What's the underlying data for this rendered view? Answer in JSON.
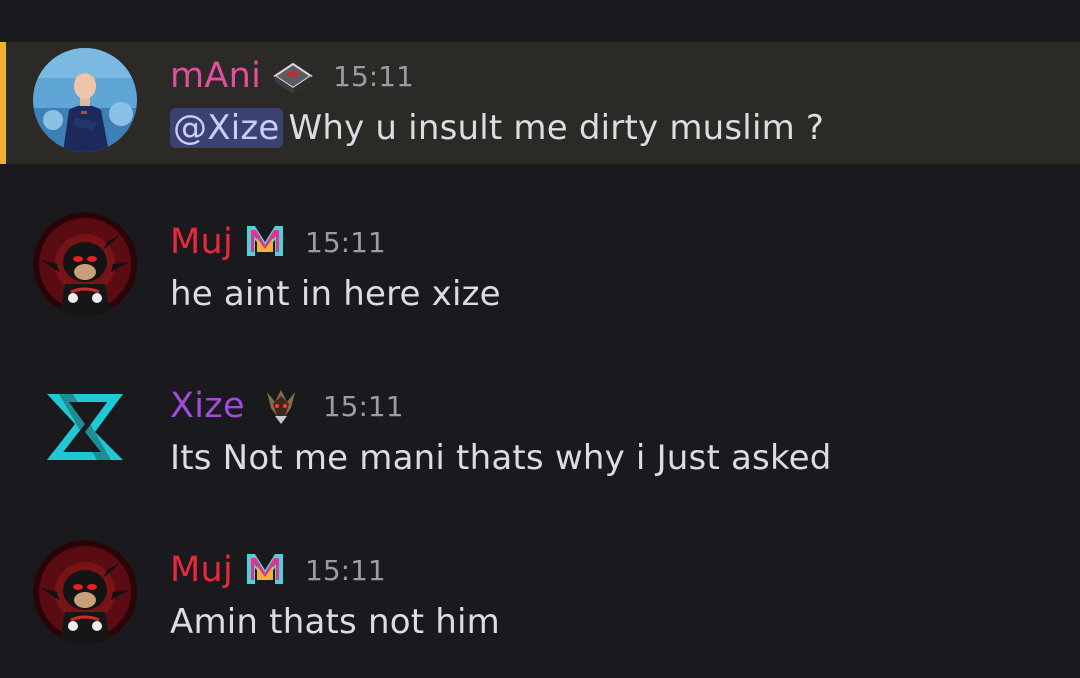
{
  "messages": [
    {
      "username": "mAni",
      "username_color": "#e0509f",
      "badge": "dark-gem-badge-icon",
      "timestamp": "15:11",
      "mention": "@Xize",
      "text": "Why u insult me dirty muslim ?",
      "highlighted": true,
      "avatar": "footballer-avatar"
    },
    {
      "username": "Muj",
      "username_color": "#e8283b",
      "badge": "m-letter-badge-icon",
      "timestamp": "15:11",
      "text": "he aint in here xize",
      "avatar": "shadow-hedgehog-avatar"
    },
    {
      "username": "Xize",
      "username_color": "#a24bd9",
      "badge": "demon-badge-icon",
      "timestamp": "15:11",
      "text": "Its Not me mani thats why i Just asked",
      "avatar": "x-logo-avatar"
    },
    {
      "username": "Muj",
      "username_color": "#e8283b",
      "badge": "m-letter-badge-icon",
      "timestamp": "15:11",
      "text": "Amin thats not him",
      "avatar": "shadow-hedgehog-avatar"
    }
  ],
  "colors": {
    "background": "#1a1a1e",
    "mention_highlight_bg": "#2b2a26",
    "mention_bar": "#f0b132",
    "mention_pill_bg": "#3c4270",
    "mention_pill_text": "#c9cdfb",
    "message_text": "#dcdde1",
    "timestamp": "#9b9ca3",
    "x_logo": "#1fc9d4"
  }
}
